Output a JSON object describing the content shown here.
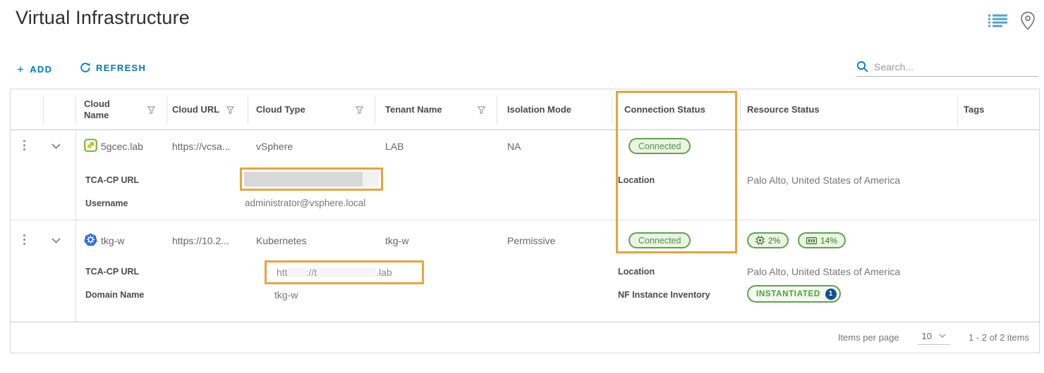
{
  "page": {
    "title": "Virtual Infrastructure"
  },
  "icons": {
    "view_toggle": "list-view-icon",
    "location_pin": "location-pin-icon",
    "search": "search-icon",
    "refresh": "refresh-icon",
    "plus": "+",
    "filter": "filter-funnel-icon",
    "kebab": "row-actions-icon",
    "chevron": "expand-chevron-icon",
    "cpu": "cpu-icon",
    "memory": "memory-icon",
    "vsphere": "vsphere-cloud-icon",
    "kubernetes": "kubernetes-cloud-icon"
  },
  "toolbar": {
    "add_label": "ADD",
    "refresh_label": "REFRESH",
    "search_placeholder": "Search..."
  },
  "table": {
    "columns": {
      "cloud_name": "Cloud Name",
      "cloud_url": "Cloud URL",
      "cloud_type": "Cloud Type",
      "tenant_name": "Tenant Name",
      "isolation_mode": "Isolation Mode",
      "connection_status": "Connection Status",
      "resource_status": "Resource Status",
      "tags": "Tags"
    },
    "rows": [
      {
        "cloud_name": "5gcec.lab",
        "cloud_url": "https://vcsa...",
        "cloud_type": "vSphere",
        "tenant_name": "LAB",
        "isolation_mode": "NA",
        "connection_status": "Connected",
        "details": {
          "tca_label": "TCA-CP URL",
          "username_label": "Username",
          "username": "administrator@vsphere.local",
          "location_label": "Location",
          "location": "Palo Alto, United States of America"
        }
      },
      {
        "cloud_name": "tkg-w",
        "cloud_url": "https://10.2...",
        "cloud_type": "Kubernetes",
        "tenant_name": "tkg-w",
        "isolation_mode": "Permissive",
        "connection_status": "Connected",
        "resource": {
          "cpu": "2%",
          "memory": "14%"
        },
        "details": {
          "tca_label": "TCA-CP URL",
          "tca_parts": [
            "htt",
            "://t",
            ".lab"
          ],
          "domain_label": "Domain Name",
          "domain": "tkg-w",
          "location_label": "Location",
          "location": "Palo Alto, United States of America",
          "nf_label": "NF Instance Inventory",
          "nf_status": "INSTANTIATED",
          "nf_count": "1"
        }
      }
    ],
    "footer": {
      "items_per_page_label": "Items per page",
      "page_size": "10",
      "range": "1 - 2 of 2 items"
    }
  },
  "colors": {
    "accent": "#0079b8",
    "success_border": "#62a152",
    "success_bg": "#e9f5e1",
    "highlight": "#e9a43c",
    "k8s_blue": "#326ce5",
    "vsphere_green": "#7ab648",
    "badge_blue": "#0d518f"
  }
}
